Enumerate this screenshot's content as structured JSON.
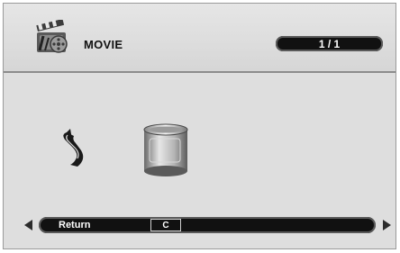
{
  "header": {
    "icon": "movie-clapper-icon",
    "title": "MOVIE",
    "page_indicator": "1 / 1"
  },
  "items": [
    {
      "icon": "return-arrow-icon",
      "kind": "parent-folder"
    },
    {
      "icon": "folder-cylinder-icon",
      "kind": "folder"
    }
  ],
  "file_bar": {
    "name": "Return",
    "code": "C"
  },
  "nav": {
    "left_icon": "triangle-left-icon",
    "right_icon": "triangle-right-icon"
  },
  "colors": {
    "panel": "#dedede",
    "bar": "#111111",
    "text_on_bar": "#ffffff"
  }
}
